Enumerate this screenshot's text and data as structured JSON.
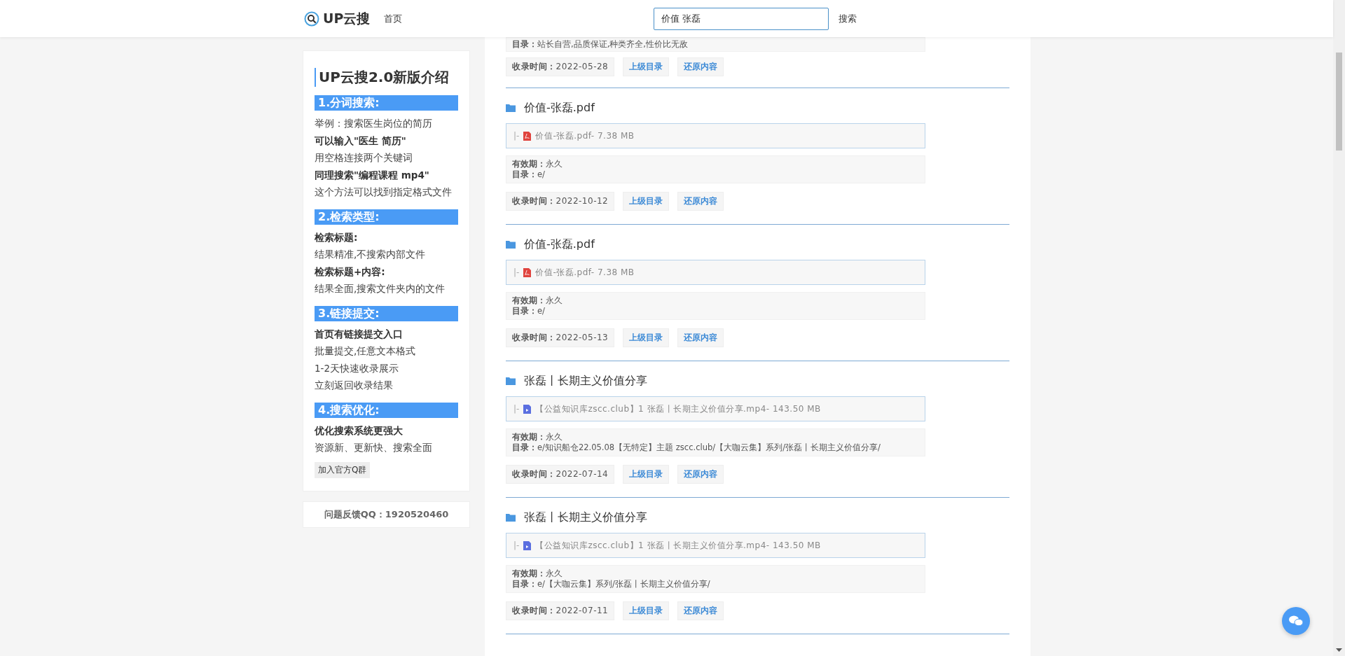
{
  "header": {
    "logo": "UP云搜",
    "nav": [
      {
        "label": "首页"
      }
    ],
    "search": {
      "value": "价值 张磊"
    },
    "search_button": "搜索"
  },
  "sidebar": {
    "title": "UP云搜2.0新版介绍",
    "sections": [
      {
        "heading": "1.分词搜索:",
        "lines": [
          {
            "text": "举例：搜索医生岗位的简历",
            "bold": false
          },
          {
            "text": "可以输入\"医生 简历\"",
            "bold": true
          },
          {
            "text": "用空格连接两个关键词",
            "bold": false
          },
          {
            "text": "同理搜索\"编程课程 mp4\"",
            "bold": true
          },
          {
            "text": "这个方法可以找到指定格式文件",
            "bold": false
          }
        ]
      },
      {
        "heading": "2.检索类型:",
        "lines": [
          {
            "text": "检索标题:",
            "bold": true
          },
          {
            "text": "结果精准,不搜索内部文件",
            "bold": false
          },
          {
            "text": "检索标题+内容:",
            "bold": true
          },
          {
            "text": "结果全面,搜索文件夹内的文件",
            "bold": false
          }
        ]
      },
      {
        "heading": "3.链接提交:",
        "lines": [
          {
            "text": "首页有链接提交入口",
            "bold": true
          },
          {
            "text": "批量提交,任意文本格式",
            "bold": false
          },
          {
            "text": "1-2天快速收录展示",
            "bold": false
          },
          {
            "text": "立刻返回收录结果",
            "bold": false
          }
        ]
      },
      {
        "heading": "4.搜索优化:",
        "lines": [
          {
            "text": "优化搜索系统更强大",
            "bold": true
          },
          {
            "text": "资源新、更新快、搜索全面",
            "bold": false
          }
        ]
      }
    ],
    "group_button": "加入官方Q群",
    "feedback": "问题反馈QQ：1920520460"
  },
  "results": [
    {
      "details": [
        "**目录：**站长自营,品质保证,种类齐全,性价比无敌"
      ],
      "time": "**收录时间：**2022-05-28",
      "buttons": [
        "上级目录",
        "还原内容"
      ]
    },
    {
      "title": "价值-张磊.pdf",
      "file": {
        "kind": "pdf",
        "marker": "|-",
        "name": "价值-张磊.pdf- 7.38 MB"
      },
      "details": [
        "**有效期：**永久",
        "**目录：**e/"
      ],
      "time": "**收录时间：**2022-10-12",
      "buttons": [
        "上级目录",
        "还原内容"
      ]
    },
    {
      "title": "价值-张磊.pdf",
      "file": {
        "kind": "pdf",
        "marker": "|-",
        "name": "价值-张磊.pdf- 7.38 MB"
      },
      "details": [
        "**有效期：**永久",
        "**目录：**e/"
      ],
      "time": "**收录时间：**2022-05-13",
      "buttons": [
        "上级目录",
        "还原内容"
      ]
    },
    {
      "title": "张磊丨长期主义价值分享",
      "file": {
        "kind": "video",
        "marker": "|-",
        "name": "【公益知识库zscc.club】1 张磊丨长期主义价值分享.mp4- 143.50 MB"
      },
      "details": [
        "**有效期：**永久",
        "**目录：**e/知识船仓22.05.08【无特定】主题 zscc.club/【大咖云集】系列/张磊丨长期主义价值分享/"
      ],
      "time": "**收录时间：**2022-07-14",
      "buttons": [
        "上级目录",
        "还原内容"
      ]
    },
    {
      "title": "张磊丨长期主义价值分享",
      "file": {
        "kind": "video",
        "marker": "|-",
        "name": "【公益知识库zscc.club】1 张磊丨长期主义价值分享.mp4- 143.50 MB"
      },
      "details": [
        "**有效期：**永久",
        "**目录：**e/【大咖云集】系列/张磊丨长期主义价值分享/"
      ],
      "time": "**收录时间：**2022-07-11",
      "buttons": [
        "上级目录",
        "还原内容"
      ]
    }
  ]
}
